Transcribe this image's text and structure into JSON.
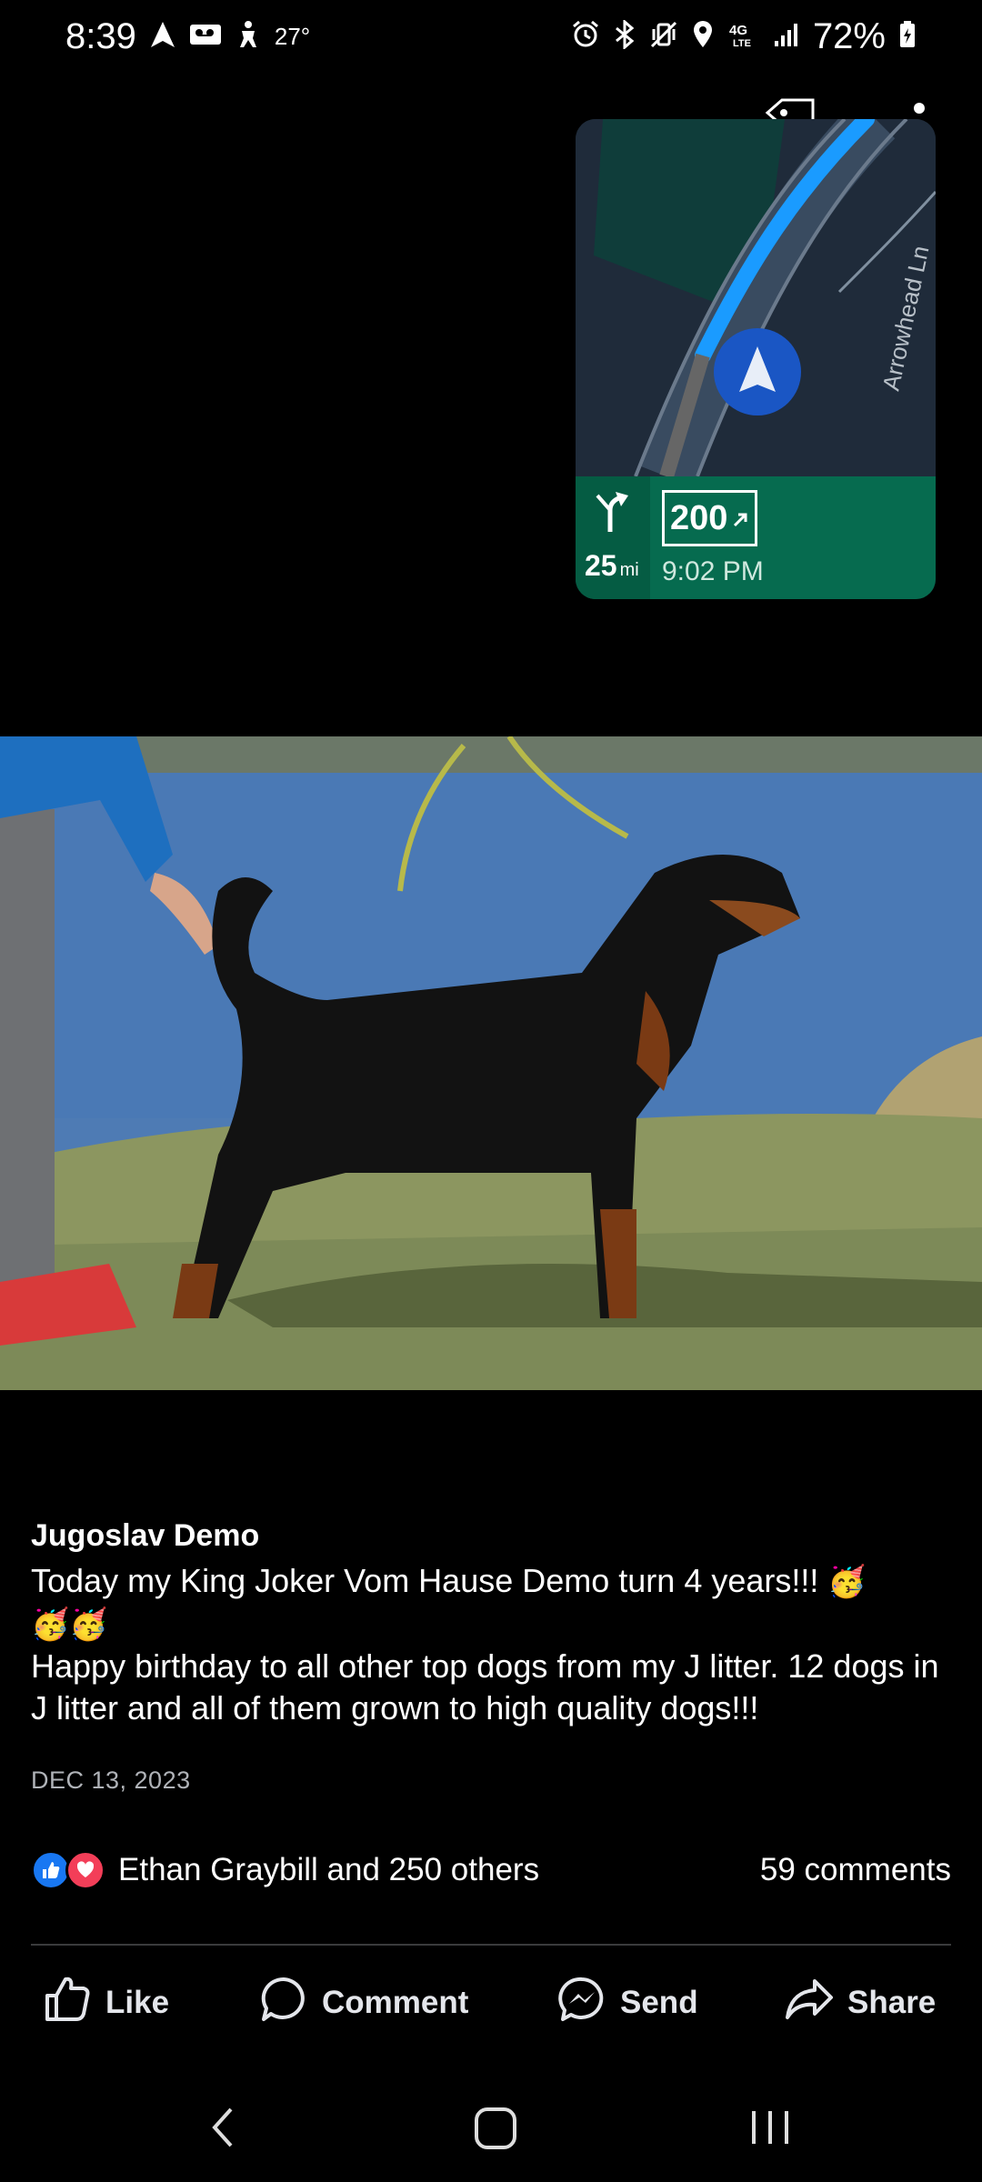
{
  "status_bar": {
    "time": "8:39",
    "temperature": "27°",
    "battery": "72%",
    "network": "4G LTE",
    "left_icons": [
      "navigation-icon",
      "voicemail-icon",
      "accessibility-icon"
    ],
    "right_icons": [
      "alarm-icon",
      "bluetooth-icon",
      "vibrate-icon",
      "location-icon",
      "signal-icon",
      "battery-icon"
    ]
  },
  "navigation_widget": {
    "street_name": "Arrowhead Ln",
    "next_turn_distance": "25",
    "distance_unit": "mi",
    "route_number": "200",
    "eta": "9:02 PM"
  },
  "post": {
    "author": "Jugoslav Demo",
    "text_line1": "Today my King Joker Vom Hause Demo turn 4 years!!!",
    "emoji_line1": "🥳",
    "emoji_line2": "🥳🥳",
    "text_line2": "Happy birthday to all other top dogs from my J litter. 12 dogs in J litter and all of them grown to high quality dogs!!!",
    "date": "DEC 13, 2023",
    "reactions_text": "Ethan Graybill and 250 others",
    "comments_text": "59 comments",
    "colors": {
      "like": "#1877f2",
      "love": "#f33e58",
      "map_route": "#1a9bff",
      "nav_footer": "#066b4f"
    }
  },
  "actions": {
    "like": "Like",
    "comment": "Comment",
    "send": "Send",
    "share": "Share"
  }
}
